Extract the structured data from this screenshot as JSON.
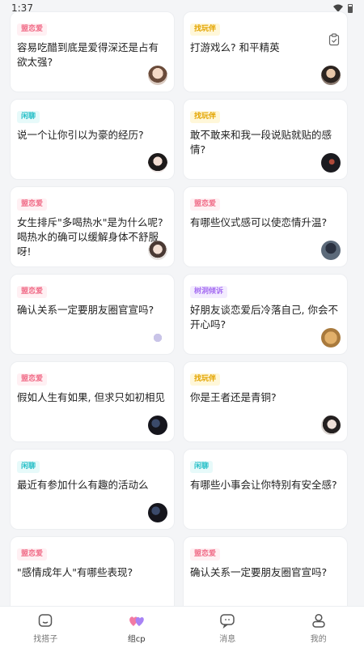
{
  "status_bar": {
    "time": "1:37"
  },
  "tag_colors": {
    "pink": "#f06a86",
    "yellow": "#e3a400",
    "cyan": "#29c0c8",
    "purple": "#a66ef2"
  },
  "cards": [
    {
      "tag": "盟恋爱",
      "tag_color": "pink",
      "title": "容易吃醋到底是爱得深还是占有欲太强?",
      "avatar_icon": "user-avatar"
    },
    {
      "tag": "找玩伴",
      "tag_color": "yellow",
      "title": "打游戏么? 和平精英",
      "avatar_icon": "user-avatar"
    },
    {
      "tag": "闲聊",
      "tag_color": "cyan",
      "title": "说一个让你引以为豪的经历?",
      "avatar_icon": "user-avatar"
    },
    {
      "tag": "找玩伴",
      "tag_color": "yellow",
      "title": "敢不敢来和我一段说贴就贴的感情?",
      "avatar_icon": "user-avatar"
    },
    {
      "tag": "盟恋爱",
      "tag_color": "pink",
      "title": "女生排斥\"多喝热水\"是为什么呢? 喝热水的确可以缓解身体不舒服呀!",
      "avatar_icon": "user-avatar"
    },
    {
      "tag": "盟恋爱",
      "tag_color": "pink",
      "title": "有哪些仪式感可以使恋情升温?",
      "avatar_icon": "user-avatar"
    },
    {
      "tag": "盟恋爱",
      "tag_color": "pink",
      "title": "确认关系一定要朋友圈官宣吗?",
      "avatar_icon": "user-avatar"
    },
    {
      "tag": "树洞倾诉",
      "tag_color": "purple",
      "title": "好朋友谈恋爱后冷落自己, 你会不开心吗?",
      "avatar_icon": "user-avatar"
    },
    {
      "tag": "盟恋爱",
      "tag_color": "pink",
      "title": "假如人生有如果, 但求只如初相见",
      "avatar_icon": "user-avatar"
    },
    {
      "tag": "找玩伴",
      "tag_color": "yellow",
      "title": "你是王者还是青铜?",
      "avatar_icon": "user-avatar"
    },
    {
      "tag": "闲聊",
      "tag_color": "cyan",
      "title": "最近有参加什么有趣的活动么",
      "avatar_icon": "user-avatar"
    },
    {
      "tag": "闲聊",
      "tag_color": "cyan",
      "title": "有哪些小事会让你特别有安全感?",
      "avatar_icon": "user-avatar"
    },
    {
      "tag": "盟恋爱",
      "tag_color": "pink",
      "title": "\"感情成年人\"有哪些表现?",
      "avatar_icon": "user-avatar"
    },
    {
      "tag": "盟恋爱",
      "tag_color": "pink",
      "title": "确认关系一定要朋友圈官宣吗?",
      "avatar_icon": "user-avatar"
    }
  ],
  "tabbar": {
    "tabs": [
      {
        "label": "找搭子",
        "icon": "home-icon",
        "active": false
      },
      {
        "label": "组cp",
        "icon": "hearts-icon",
        "active": true
      },
      {
        "label": "消息",
        "icon": "message-icon",
        "active": false
      },
      {
        "label": "我的",
        "icon": "profile-icon",
        "active": false
      }
    ]
  }
}
